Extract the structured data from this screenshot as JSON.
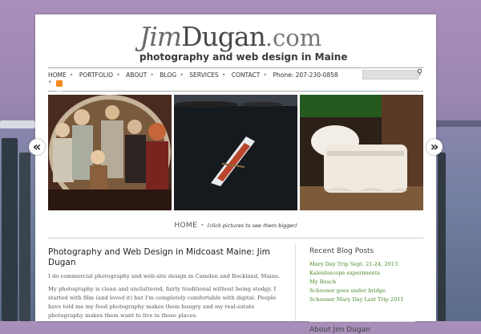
{
  "header": {
    "logo_first": "Jim",
    "logo_last": "Dugan",
    "logo_tld": ".com",
    "tagline": "photography and web design in Maine"
  },
  "nav": {
    "items": [
      {
        "label": "HOME"
      },
      {
        "label": "PORTFOLIO"
      },
      {
        "label": "ABOUT"
      },
      {
        "label": "BLOG"
      },
      {
        "label": "SERVICES"
      },
      {
        "label": "CONTACT"
      },
      {
        "label": "Phone: 207-230-0858"
      }
    ],
    "rss_icon": "rss-icon",
    "search_placeholder": "",
    "search_icon": "search-icon"
  },
  "slider": {
    "slides": [
      {
        "alt": "costumed performers group photo"
      },
      {
        "alt": "white rowboat on dark water"
      },
      {
        "alt": "white ruffled baby crib"
      }
    ],
    "prev_icon": "chevron-left-icon",
    "next_icon": "chevron-right-icon"
  },
  "home_row": {
    "home": "HOME",
    "note": "(click pictures to see them bigger)"
  },
  "main": {
    "title": "Photography and Web Design in Midcoast Maine: Jim Dugan",
    "p1": "I do commercial photography and web-site design in Camden and Rockland, Maine.",
    "p2": "My photography is clean and uncluttered, fairly traditional without being stodgy. I started with film (and loved it) but I'm completely comfortable with digital. People have told me my food photography makes them hungry and my real-estate photography makes them want to live in those places."
  },
  "sidebar": {
    "recent_title": "Recent Blog Posts",
    "posts": [
      "Mary Day Trip Sept. 21-24, 2013",
      "Kaleidoscope experiments",
      "My Beach",
      "Schooner goes under bridge",
      "Schooner Mary Day Last Trip 2011"
    ],
    "about_title": "About Jim Dugan"
  },
  "colors": {
    "link_green": "#4a8b2a",
    "rss_orange": "#f28a1c"
  }
}
